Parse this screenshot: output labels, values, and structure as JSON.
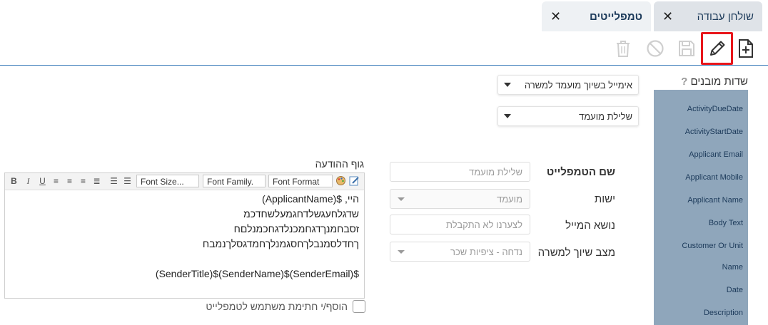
{
  "tabs": [
    {
      "label": "שולחן עבודה",
      "close": "✕"
    },
    {
      "label": "טמפלייטים",
      "close": "✕"
    }
  ],
  "toolbar": {
    "icons": [
      "new-document-icon",
      "pencil-icon",
      "save-icon",
      "cancel-icon",
      "trash-icon"
    ],
    "accent_color": "#2f74b5",
    "highlight_color": "#e8161b"
  },
  "fields": {
    "title": "שדות מובנים",
    "help": "?",
    "items": [
      "ActivityDueDate",
      "ActivityStartDate",
      "Applicant Email",
      "Applicant Mobile",
      "Applicant Name",
      "Body Text",
      "Customer Or Unit",
      "Name",
      "Date",
      "Description"
    ]
  },
  "dropdowns": {
    "type": "אימייל בשיוך מועמד למשרה",
    "status": "שלילת מועמד"
  },
  "form": {
    "name_label": "שם הטמפלייט",
    "name_placeholder": "שלילת מועמד",
    "entity_label": "ישות",
    "entity_value": "מועמד",
    "subject_label": "נושא המייל",
    "subject_placeholder": "לצערנו לא התקבלת",
    "stage_label": "מצב שיוך למשרה",
    "stage_value": "נדחה - ציפיות שכר"
  },
  "editor": {
    "label": "גוף ההודעה",
    "font_format": "Font Format",
    "font_family": "Font Family.",
    "font_size": "Font Size...",
    "lines": [
      "היי, $(ApplicantName)",
      "שדגלחעגשלדחגמעלשחדכמ",
      "זסבחמנךדגחמכנלדגחכמנלםח",
      "ךחדלסמנבלךחסגמנלךחמדגסלךנמבח",
      "",
      "$(SenderEmail)$(SenderName)$(SenderTitle)"
    ]
  },
  "signature": {
    "label": "הוסף/י חתימת משתמש לטמפלייט",
    "checked": false
  }
}
